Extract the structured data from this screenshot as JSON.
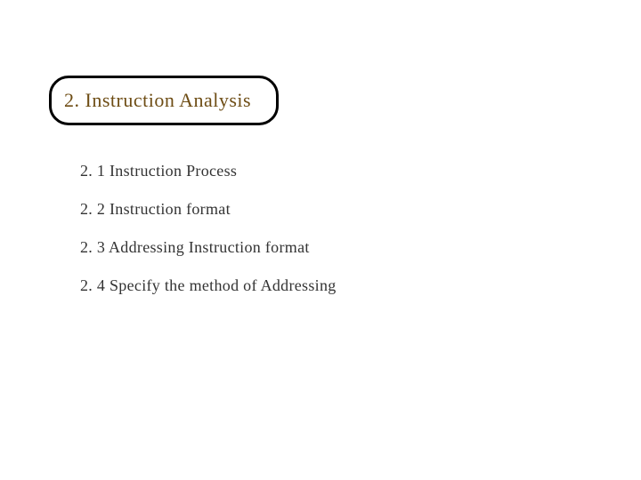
{
  "title": "2. Instruction Analysis",
  "items": [
    "2. 1 Instruction Process",
    "2. 2 Instruction format",
    "2. 3 Addressing Instruction format",
    "2. 4 Specify the method of Addressing"
  ]
}
